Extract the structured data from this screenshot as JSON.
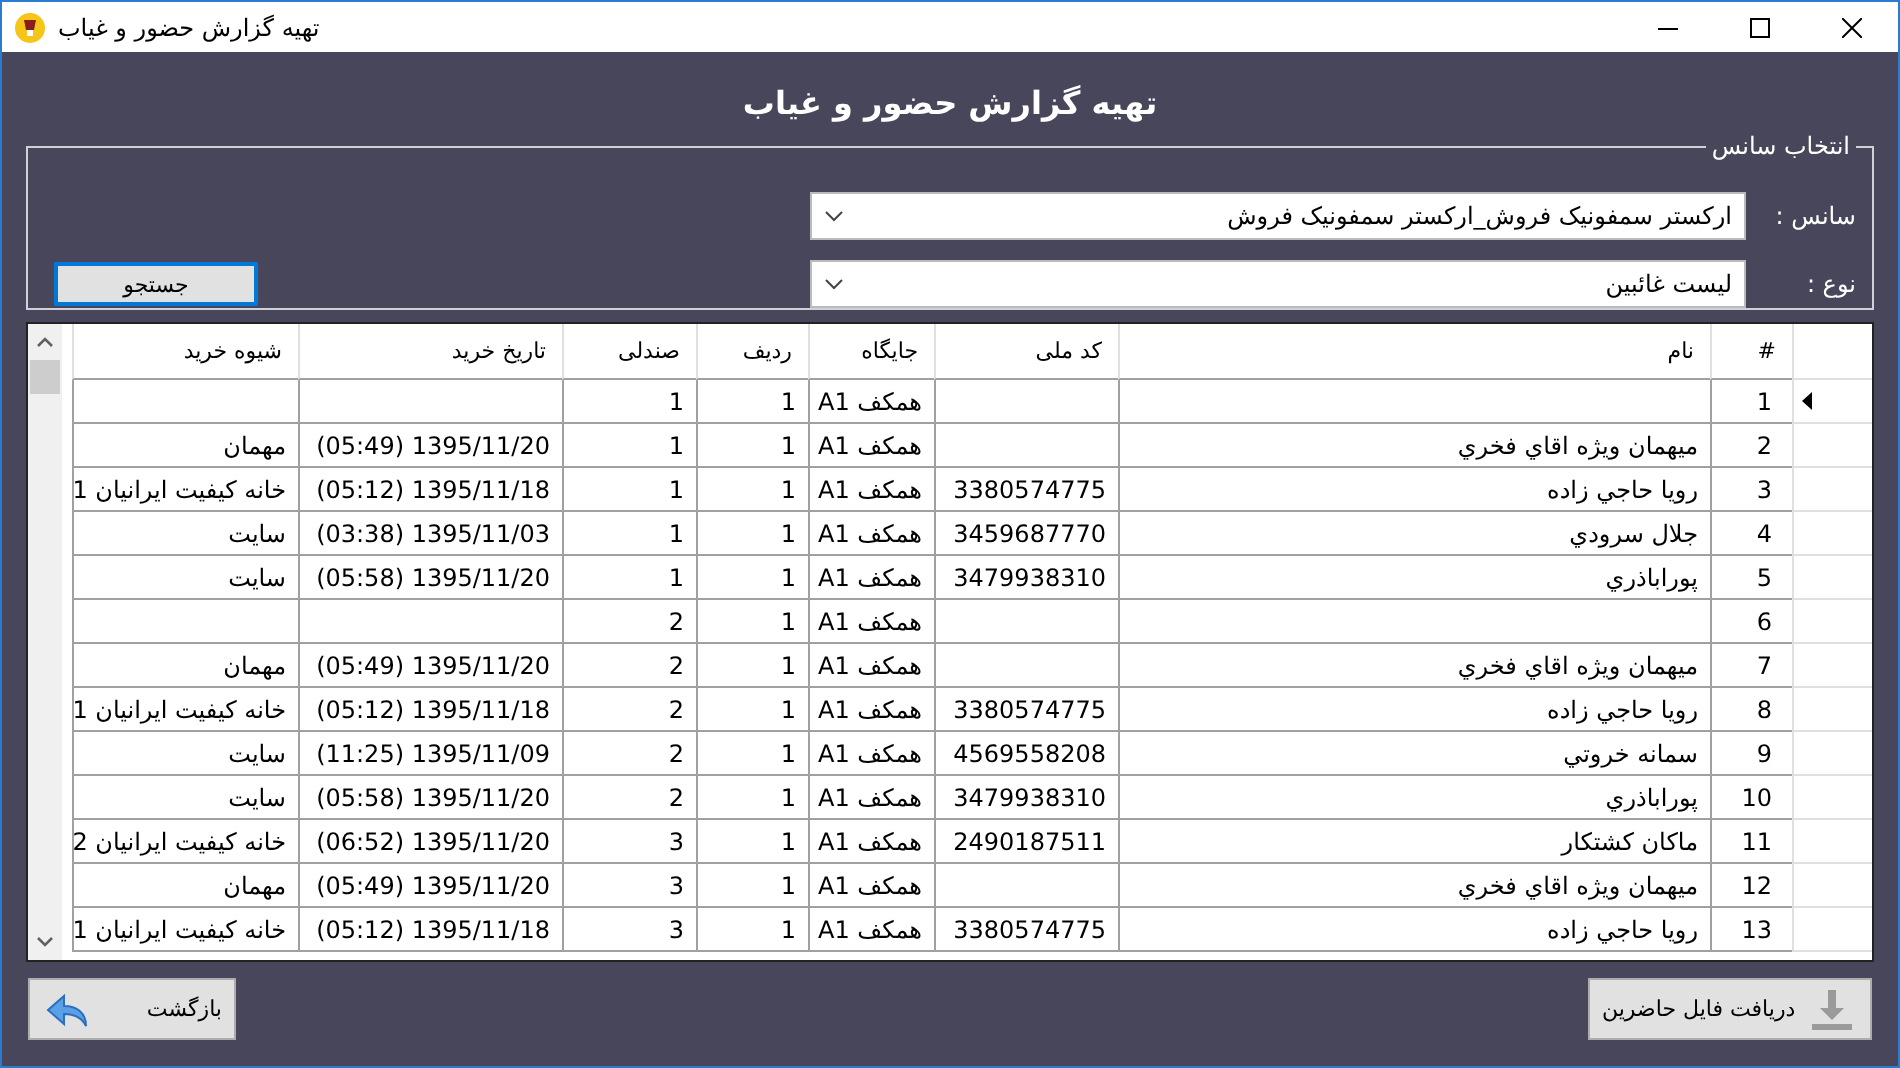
{
  "window": {
    "title": "تهیه گزارش حضور و غیاب"
  },
  "heading": "تهیه گزارش حضور و غیاب",
  "session_group": {
    "title": "انتخاب سانس",
    "fields": [
      {
        "label": "سانس :",
        "value": "ارکستر سمفونیک فروش_ارکستر سمفونیک فروش"
      },
      {
        "label": "نوع :",
        "value": "لیست غائبین"
      }
    ],
    "search_button": "جستجو"
  },
  "table": {
    "columns": [
      "#",
      "نام",
      "کد ملی",
      "جایگاه",
      "ردیف",
      "صندلی",
      "تاریخ خرید",
      "شیوه خرید"
    ],
    "rows": [
      {
        "current": true,
        "num": "1",
        "place": "همکف  A1",
        "row": "1",
        "seat": "1"
      },
      {
        "current": false,
        "num": "2",
        "name": "میهمان ویژه اقاي فخري",
        "place": "همکف  A1",
        "row": "1",
        "seat": "1",
        "date": "(05:49) 1395/11/20",
        "method": "مهمان"
      },
      {
        "current": false,
        "num": "3",
        "name": "رویا حاجي زاده",
        "code": "3380574775",
        "place": "همکف  A1",
        "row": "1",
        "seat": "1",
        "date": "(05:12) 1395/11/18",
        "method": "خانه کیفیت ایرانیان 1"
      },
      {
        "current": false,
        "num": "4",
        "name": "جلال سرودي",
        "code": "3459687770",
        "place": "همکف  A1",
        "row": "1",
        "seat": "1",
        "date": "(03:38) 1395/11/03",
        "method": "سایت"
      },
      {
        "current": false,
        "num": "5",
        "name": "پوراباذري",
        "code": "3479938310",
        "place": "همکف  A1",
        "row": "1",
        "seat": "1",
        "date": "(05:58) 1395/11/20",
        "method": "سایت"
      },
      {
        "current": false,
        "num": "6",
        "place": "همکف  A1",
        "row": "1",
        "seat": "2"
      },
      {
        "current": false,
        "num": "7",
        "name": "میهمان ویژه اقاي فخري",
        "place": "همکف  A1",
        "row": "1",
        "seat": "2",
        "date": "(05:49) 1395/11/20",
        "method": "مهمان"
      },
      {
        "current": false,
        "num": "8",
        "name": "رویا حاجي زاده",
        "code": "3380574775",
        "place": "همکف  A1",
        "row": "1",
        "seat": "2",
        "date": "(05:12) 1395/11/18",
        "method": "خانه کیفیت ایرانیان 1"
      },
      {
        "current": false,
        "num": "9",
        "name": "سمانه خروتي",
        "code": "4569558208",
        "place": "همکف  A1",
        "row": "1",
        "seat": "2",
        "date": "(11:25) 1395/11/09",
        "method": "سایت"
      },
      {
        "current": false,
        "num": "10",
        "name": "پوراباذري",
        "code": "3479938310",
        "place": "همکف  A1",
        "row": "1",
        "seat": "2",
        "date": "(05:58) 1395/11/20",
        "method": "سایت"
      },
      {
        "current": false,
        "num": "11",
        "name": "ماکان کشتکار",
        "code": "2490187511",
        "place": "همکف  A1",
        "row": "1",
        "seat": "3",
        "date": "(06:52) 1395/11/20",
        "method": "خانه کیفیت ایرانیان 2"
      },
      {
        "current": false,
        "num": "12",
        "name": "میهمان ویژه اقاي فخري",
        "place": "همکف  A1",
        "row": "1",
        "seat": "3",
        "date": "(05:49) 1395/11/20",
        "method": "مهمان"
      },
      {
        "current": false,
        "num": "13",
        "name": "رویا حاجي زاده",
        "code": "3380574775",
        "place": "همکف  A1",
        "row": "1",
        "seat": "3",
        "date": "(05:12) 1395/11/18",
        "method": "خانه کیفیت ایرانیان 1"
      }
    ]
  },
  "footer": {
    "download_button": "دریافت فایل حاضرین",
    "back_button": "بازگشت"
  }
}
